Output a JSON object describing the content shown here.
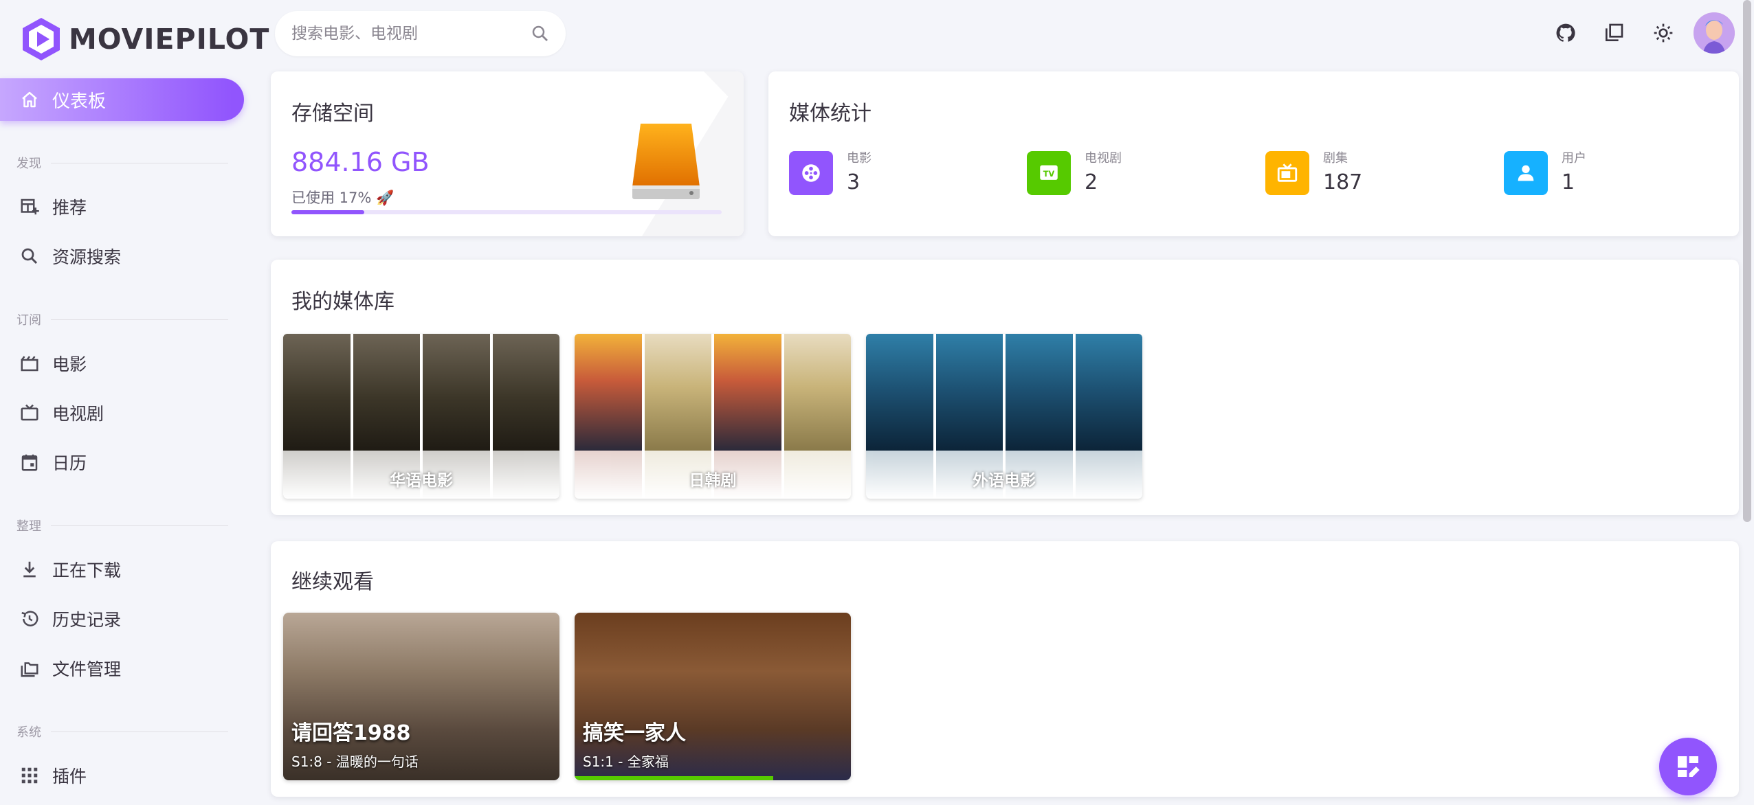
{
  "app": {
    "name": "MOVIEPILOT"
  },
  "search": {
    "placeholder": "搜索电影、电视剧"
  },
  "nav": {
    "dashboard": "仪表板",
    "sections": {
      "discover": "发现",
      "subscribe": "订阅",
      "organize": "整理",
      "system": "系统"
    },
    "items": {
      "recommend": "推荐",
      "resource_search": "资源搜索",
      "movies": "电影",
      "tv": "电视剧",
      "calendar": "日历",
      "downloading": "正在下载",
      "history": "历史记录",
      "file_manager": "文件管理",
      "plugins": "插件"
    }
  },
  "storage": {
    "title": "存储空间",
    "value": "884.16 GB",
    "used_label": "已使用 17% 🚀",
    "used_percent": 17
  },
  "media_stats": {
    "title": "媒体统计",
    "items": [
      {
        "label": "电影",
        "value": "3",
        "color": "#9155fd",
        "icon": "movie-reel-icon"
      },
      {
        "label": "电视剧",
        "value": "2",
        "color": "#56ca00",
        "icon": "tv-icon"
      },
      {
        "label": "剧集",
        "value": "187",
        "color": "#ffb400",
        "icon": "episode-tv-icon"
      },
      {
        "label": "用户",
        "value": "1",
        "color": "#16b1ff",
        "icon": "user-icon"
      }
    ]
  },
  "library": {
    "title": "我的媒体库",
    "items": [
      {
        "name": "华语电影"
      },
      {
        "name": "日韩剧"
      },
      {
        "name": "外语电影"
      }
    ]
  },
  "continue": {
    "title": "继续观看",
    "items": [
      {
        "title": "请回答1988",
        "subtitle": "S1:8 - 温暖的一句话",
        "progress": 0
      },
      {
        "title": "搞笑一家人",
        "subtitle": "S1:1 - 全家福",
        "progress": 0.72
      }
    ]
  },
  "colors": {
    "accent": "#9155fd",
    "success": "#56ca00",
    "warning": "#ffb400",
    "info": "#16b1ff"
  }
}
